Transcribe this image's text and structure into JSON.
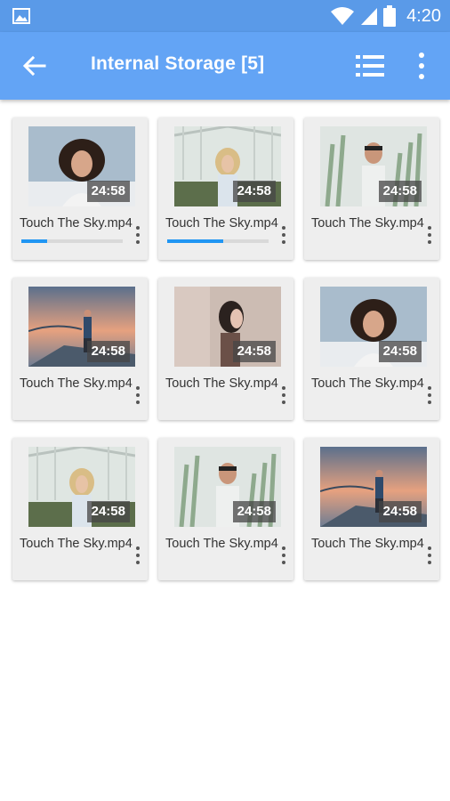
{
  "status_bar": {
    "time": "4:20",
    "icons": [
      "gallery-icon",
      "wifi-icon",
      "signal-icon",
      "battery-icon"
    ]
  },
  "app_bar": {
    "title": "Internal Storage [5]",
    "icons": [
      "back-arrow-icon",
      "list-view-icon",
      "more-vert-icon"
    ],
    "background": "#63a4f5"
  },
  "videos": [
    {
      "name": "Touch The Sky.mp4",
      "duration": "24:58",
      "thumb": "curly",
      "progress": 0.25
    },
    {
      "name": "Touch The Sky.mp4",
      "duration": "24:58",
      "thumb": "greenhouse",
      "progress": 0.55
    },
    {
      "name": "Touch The Sky.mp4",
      "duration": "24:58",
      "thumb": "plants",
      "progress": null
    },
    {
      "name": "Touch The Sky.mp4",
      "duration": "24:58",
      "thumb": "sunset",
      "progress": null
    },
    {
      "name": "Touch The Sky.mp4",
      "duration": "24:58",
      "thumb": "profile",
      "progress": null
    },
    {
      "name": "Touch The Sky.mp4",
      "duration": "24:58",
      "thumb": "curly",
      "progress": null
    },
    {
      "name": "Touch The Sky.mp4",
      "duration": "24:58",
      "thumb": "greenhouse",
      "progress": null
    },
    {
      "name": "Touch The Sky.mp4",
      "duration": "24:58",
      "thumb": "plants",
      "progress": null
    },
    {
      "name": "Touch The Sky.mp4",
      "duration": "24:58",
      "thumb": "sunset",
      "progress": null
    }
  ],
  "colors": {
    "status_bar": "#5a9ae8",
    "progress_fill": "#2196f3",
    "card_background": "#eeeeee"
  }
}
